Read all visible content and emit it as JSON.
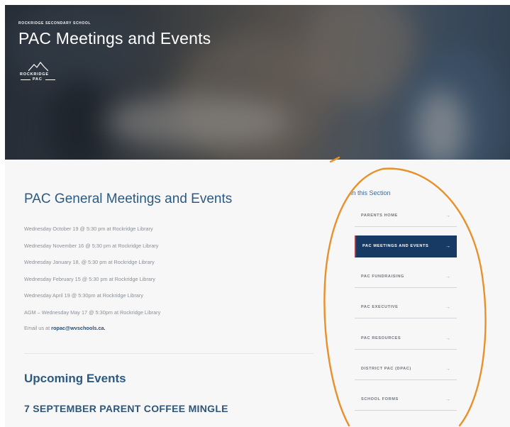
{
  "hero": {
    "school_name": "ROCKRIDGE SECONDARY SCHOOL",
    "title": "PAC Meetings and Events",
    "logo_word": "ROCKRIDGE",
    "logo_pac": "PAC"
  },
  "main": {
    "title": "PAC General Meetings and Events",
    "meetings": [
      "Wednesday October 19 @ 5:30 pm at Rockridge Library",
      "Wednesday November 16 @ 5:30 pm at Rockridge Library",
      "Wednesday January 18, @ 5:30 pm at Rockridge Library",
      "Wednesday February 15 @ 5:30 pm at Rockridge Library",
      "Wednesday April 19 @ 5:30pm at Rockridge Library",
      "AGM – Wednesday May 17 @ 5:30pm at Rockridge Library"
    ],
    "email_prefix": "Email us at",
    "email": "ropac@wvschools.ca.",
    "upcoming_title": "Upcoming Events",
    "event_title": "7 SEPTEMBER PARENT COFFEE MINGLE"
  },
  "sidebar": {
    "heading": "In this Section",
    "arrow": "→",
    "items": [
      {
        "label": "PARENTS HOME"
      },
      {
        "label": "PAC MEETINGS AND EVENTS"
      },
      {
        "label": "PAC FUNDRAISING"
      },
      {
        "label": "PAC EXECUTIVE"
      },
      {
        "label": "PAC RESOURCES"
      },
      {
        "label": "DISTRICT PAC (DPAC)"
      },
      {
        "label": "SCHOOL FORMS"
      }
    ],
    "active_index": 1
  },
  "colors": {
    "heading_blue": "#2b5a82",
    "active_nav_bg": "#163a63",
    "annotation_orange": "#e8902a"
  }
}
